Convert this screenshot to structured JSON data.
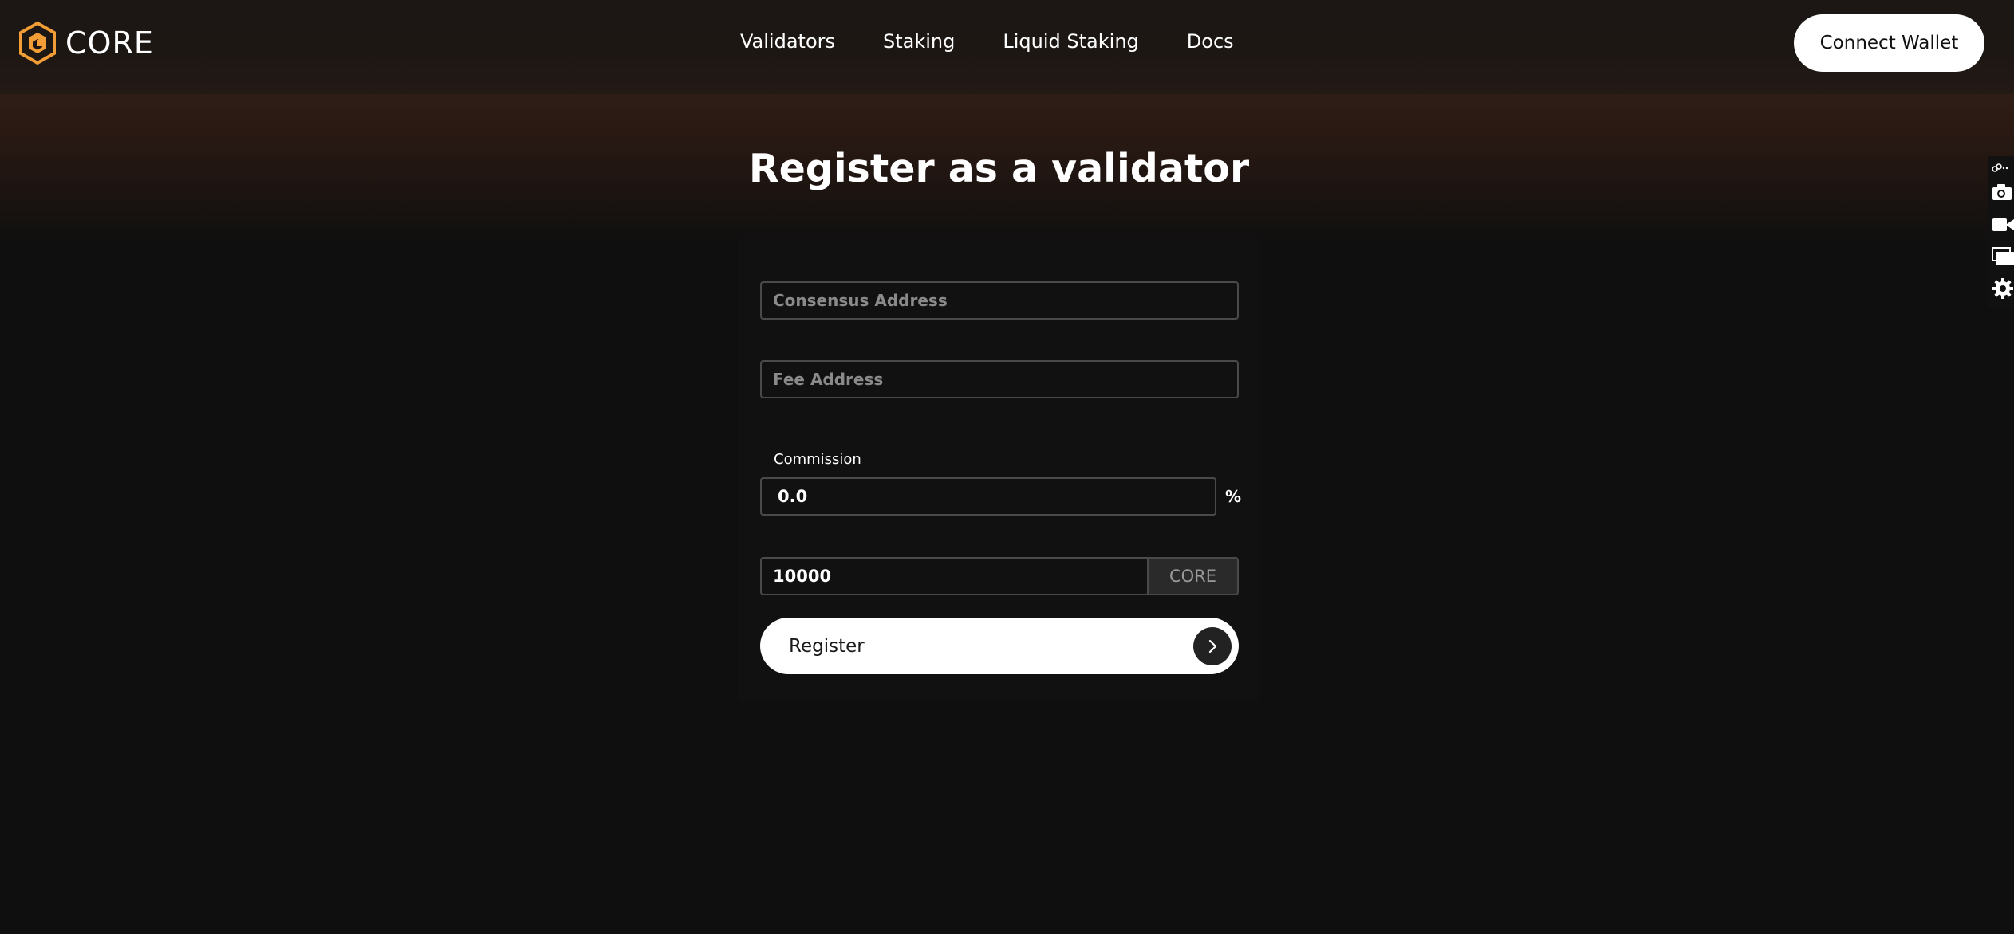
{
  "header": {
    "logo_text": "CORE",
    "nav": [
      {
        "label": "Validators"
      },
      {
        "label": "Staking"
      },
      {
        "label": "Liquid Staking"
      },
      {
        "label": "Docs"
      }
    ],
    "connect_wallet_label": "Connect Wallet"
  },
  "main": {
    "title": "Register as a validator",
    "consensus_address": {
      "placeholder": "Consensus Address",
      "value": ""
    },
    "fee_address": {
      "placeholder": "Fee Address",
      "value": ""
    },
    "commission": {
      "label": "Commission",
      "value": "0.0",
      "unit": "%"
    },
    "amount": {
      "value": "10000",
      "unit": "CORE"
    },
    "register_label": "Register"
  },
  "side_toolbar": {
    "icons": [
      "link-icon",
      "camera-icon",
      "video-icon",
      "window-icon",
      "gear-icon"
    ]
  },
  "colors": {
    "background": "#0f0f0f",
    "header": "#1c1614",
    "accent_orange": "#f29d35",
    "button_bg": "#ffffff",
    "input_border": "#4a4a4a"
  }
}
